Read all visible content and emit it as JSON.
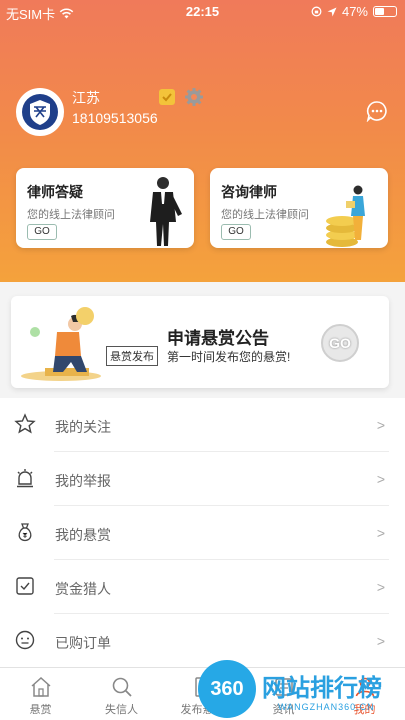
{
  "status_bar": {
    "carrier": "无SIM卡",
    "time": "22:15",
    "battery_text": "47%",
    "battery_level": 0.47
  },
  "profile": {
    "name": "江苏",
    "phone": "18109513056"
  },
  "cards": [
    {
      "title": "律师答疑",
      "subtitle": "您的线上法律顾问",
      "button": "GO"
    },
    {
      "title": "咨询律师",
      "subtitle": "您的线上法律顾问",
      "button": "GO"
    }
  ],
  "banner": {
    "tag": "悬赏发布",
    "title": "申请悬赏公告",
    "subtitle": "第一时间发布您的悬赏!",
    "button": "GO"
  },
  "menu": [
    {
      "label": "我的关注",
      "icon": "star-icon",
      "arrow": ">"
    },
    {
      "label": "我的举报",
      "icon": "alarm-icon",
      "arrow": ">"
    },
    {
      "label": "我的悬赏",
      "icon": "money-bag-icon",
      "arrow": ">"
    },
    {
      "label": "赏金猎人",
      "icon": "checkbox-icon",
      "arrow": ">"
    },
    {
      "label": "已购订单",
      "icon": "face-icon",
      "arrow": ">"
    }
  ],
  "tabs": [
    {
      "label": "悬赏",
      "icon": "home-icon"
    },
    {
      "label": "失信人",
      "icon": "search-icon"
    },
    {
      "label": "发布悬赏",
      "icon": "document-icon"
    },
    {
      "label": "资讯",
      "icon": "news-icon"
    },
    {
      "label": "我的",
      "icon": "user-icon",
      "active": true
    }
  ],
  "watermark": {
    "logo_text": "360",
    "title": "网站排行榜",
    "subtitle": "WANGZHAN360.CN"
  },
  "colors": {
    "header_top": "#f07a5a",
    "header_bottom": "#f4a23c",
    "active_tab": "#e8552f"
  }
}
